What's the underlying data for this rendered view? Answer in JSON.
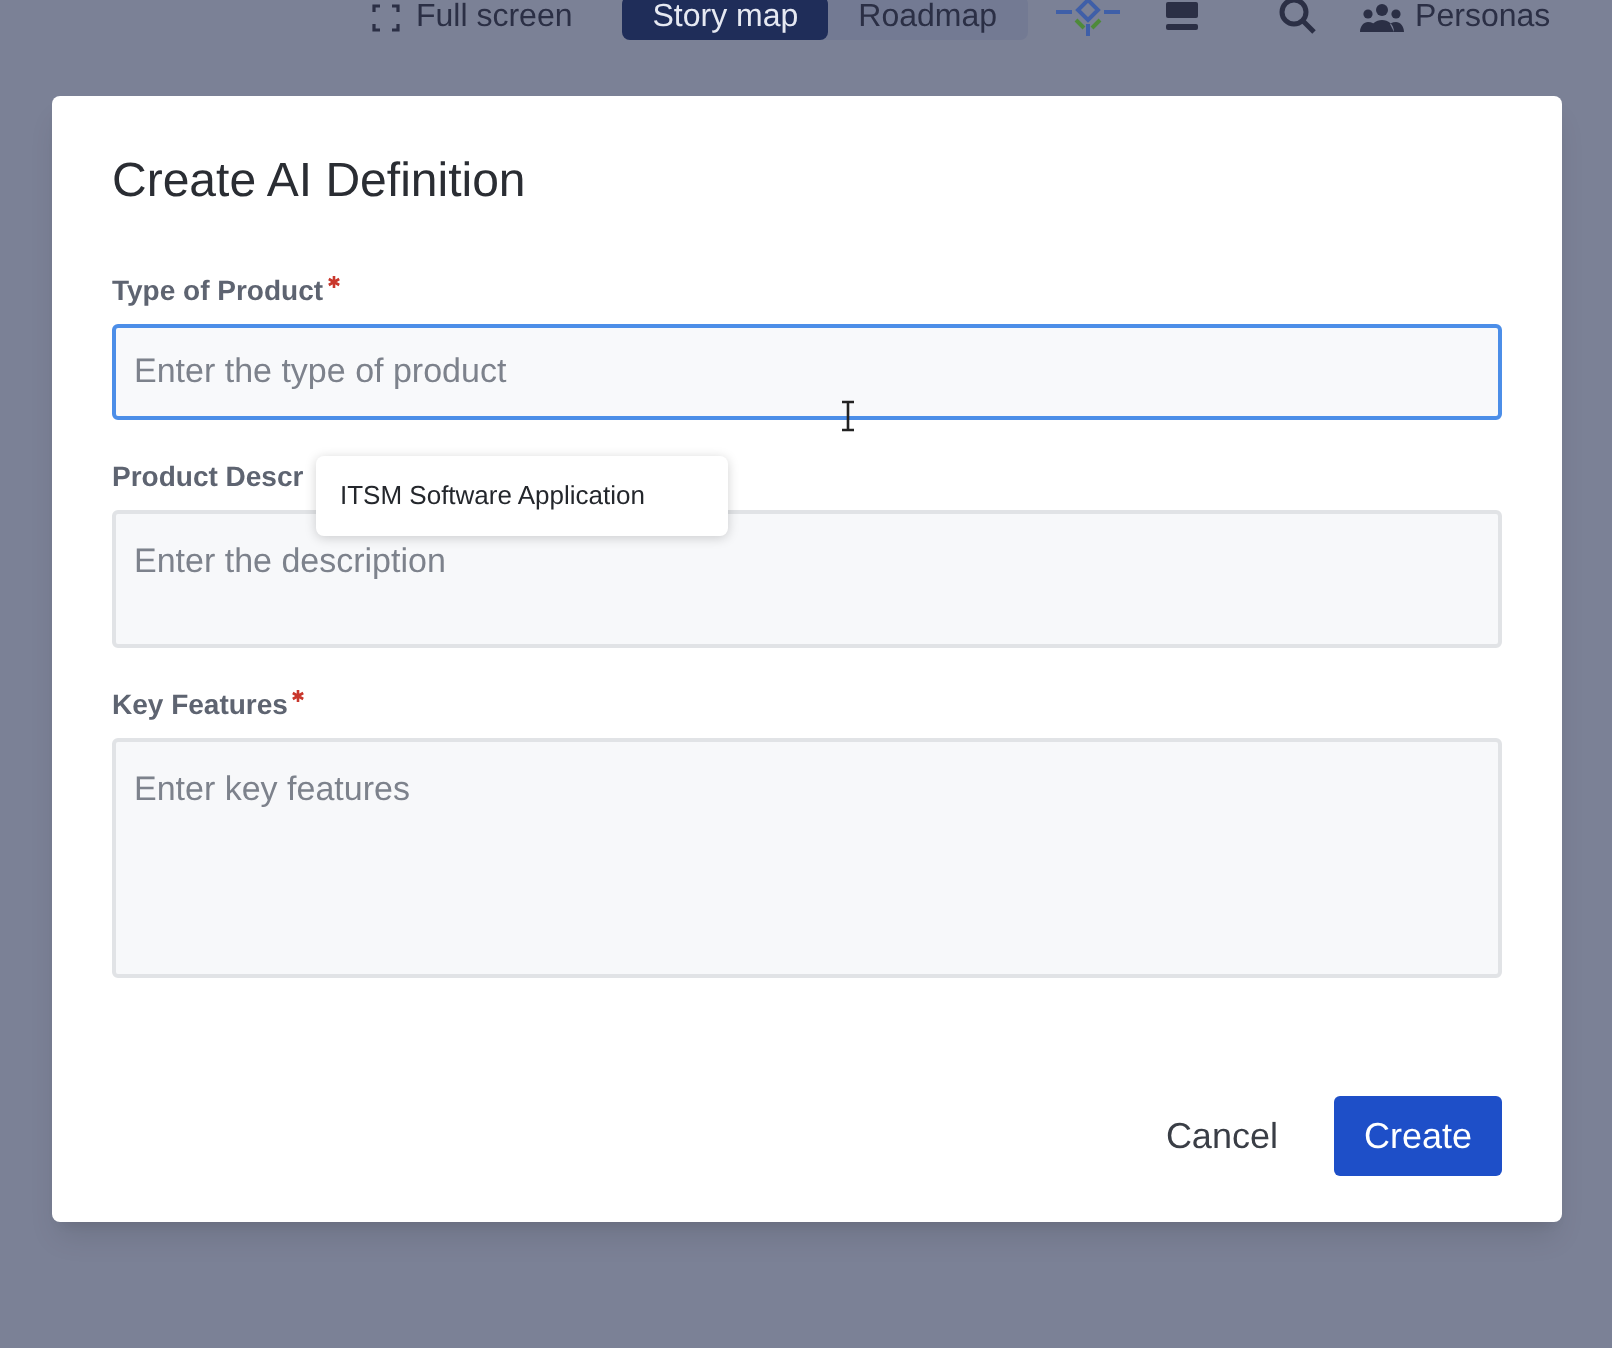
{
  "toolbar": {
    "fullscreen": "Full screen",
    "view_tabs": [
      {
        "label": "Story map",
        "selected": true
      },
      {
        "label": "Roadmap",
        "selected": false
      }
    ],
    "personas": "Personas"
  },
  "dialog": {
    "title": "Create AI Definition",
    "fields": [
      {
        "kind": "input",
        "label": "Type of Product",
        "required": true,
        "placeholder": "Enter the type of product",
        "focused": true
      },
      {
        "kind": "textarea",
        "label": "Product Descr",
        "required": false,
        "placeholder": "Enter the description",
        "focused": false
      },
      {
        "kind": "textarea",
        "label": "Key Features",
        "required": true,
        "placeholder": "Enter key features",
        "focused": false
      }
    ],
    "tooltip": "ITSM Software Application",
    "buttons": [
      {
        "label": "Cancel",
        "kind": "secondary"
      },
      {
        "label": "Create",
        "kind": "primary"
      }
    ]
  }
}
